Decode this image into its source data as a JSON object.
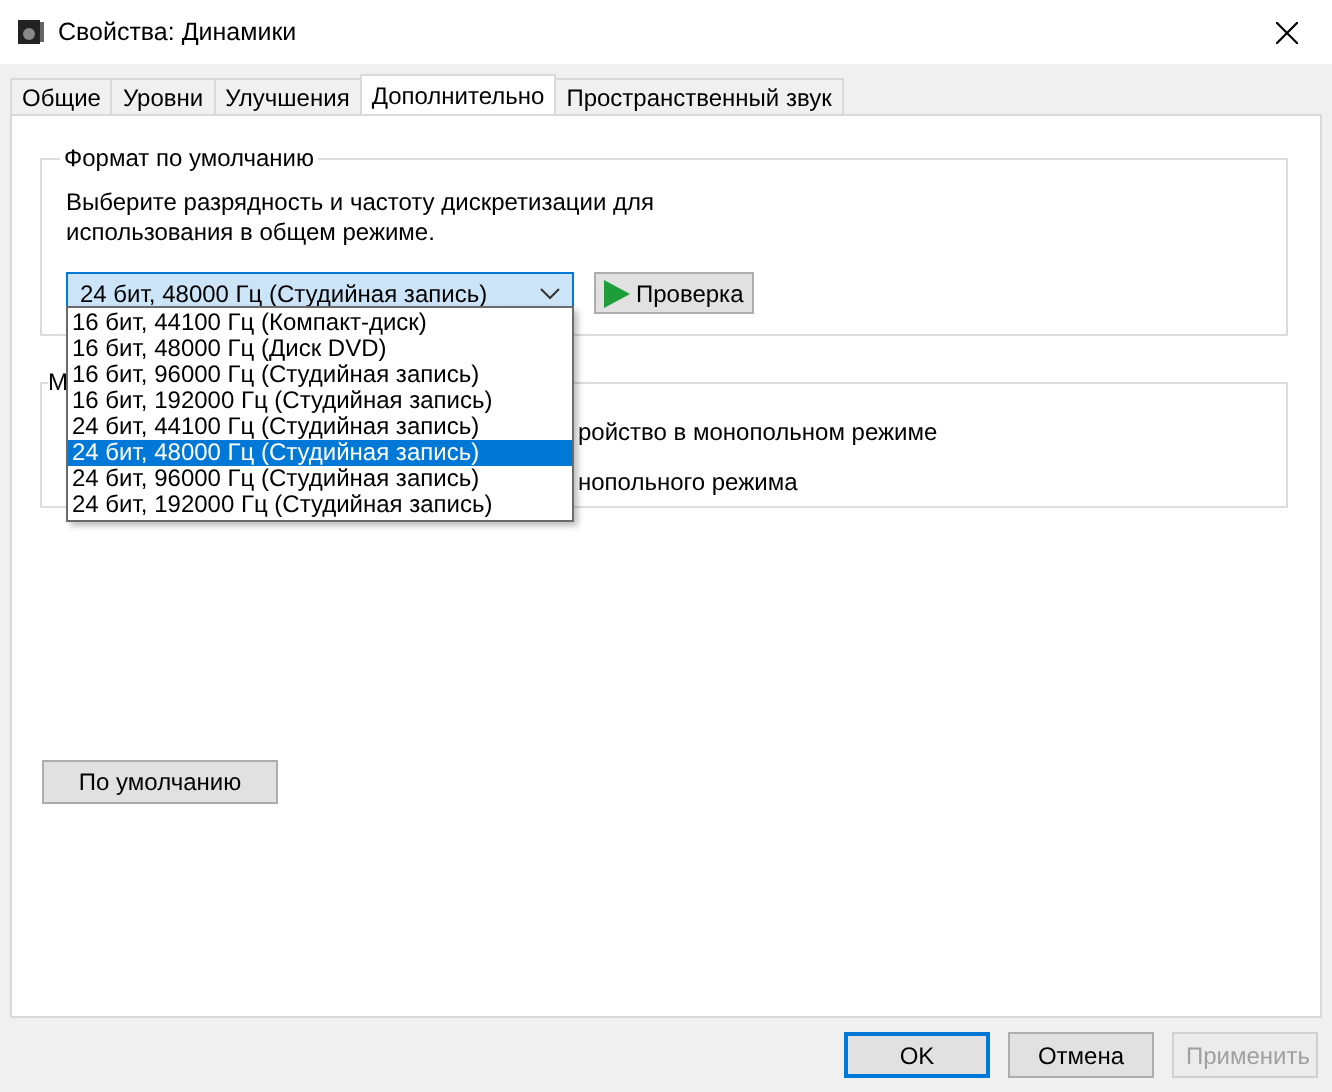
{
  "window": {
    "title": "Свойства: Динамики"
  },
  "tabs": [
    {
      "label": "Общие",
      "selected": false
    },
    {
      "label": "Уровни",
      "selected": false
    },
    {
      "label": "Улучшения",
      "selected": false
    },
    {
      "label": "Дополнительно",
      "selected": true
    },
    {
      "label": "Пространственный звук",
      "selected": false
    }
  ],
  "format_group": {
    "legend": "Формат по умолчанию",
    "description": "Выберите разрядность и частоту дискретизации для\nиспользования в общем режиме.",
    "select": {
      "value": "24 бит, 48000 Гц (Студийная запись)",
      "expanded": true,
      "options": [
        {
          "label": "16 бит, 44100 Гц (Компакт-диск)",
          "selected": false
        },
        {
          "label": "16 бит, 48000 Гц (Диск DVD)",
          "selected": false
        },
        {
          "label": "16 бит, 96000 Гц (Студийная запись)",
          "selected": false
        },
        {
          "label": "16 бит, 192000 Гц (Студийная запись)",
          "selected": false
        },
        {
          "label": "24 бит, 44100 Гц (Студийная запись)",
          "selected": false
        },
        {
          "label": "24 бит, 48000 Гц (Студийная запись)",
          "selected": true
        },
        {
          "label": "24 бит, 96000 Гц (Студийная запись)",
          "selected": false
        },
        {
          "label": "24 бит, 192000 Гц (Студийная запись)",
          "selected": false
        }
      ]
    },
    "test_button": "Проверка"
  },
  "exclusive_group": {
    "legend": "М",
    "options": [
      {
        "label": "ройство в монопольном режиме"
      },
      {
        "label": "нопольного режима"
      }
    ]
  },
  "restore_button": "По умолчанию",
  "buttons": [
    {
      "label": "OK",
      "kind": "default",
      "disabled": false
    },
    {
      "label": "Отмена",
      "kind": "normal",
      "disabled": false
    },
    {
      "label": "Применить",
      "kind": "normal",
      "disabled": true
    }
  ]
}
